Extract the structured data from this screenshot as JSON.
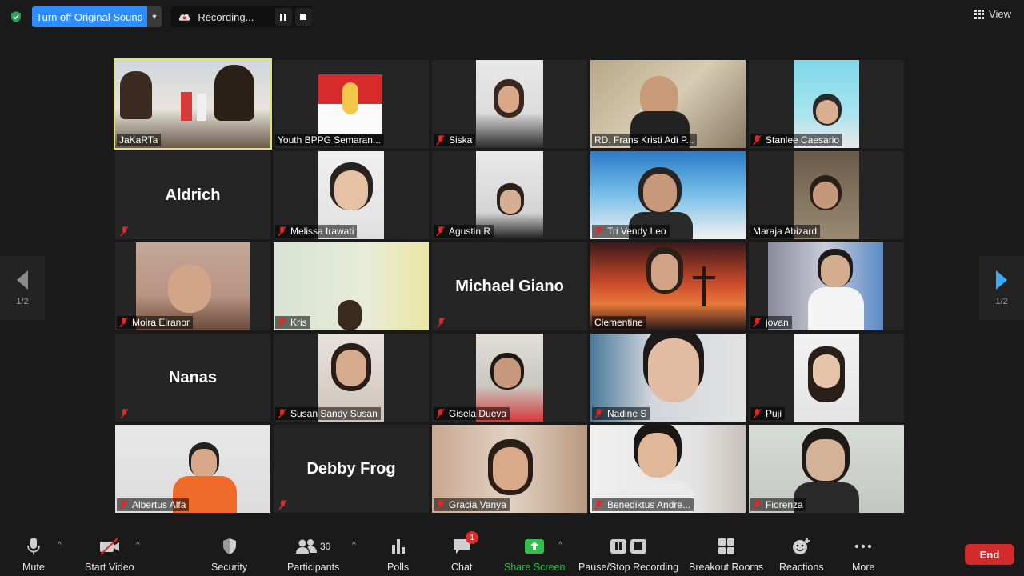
{
  "top": {
    "original_sound_label": "Turn off Original Sound",
    "recording_label": "Recording...",
    "view_label": "View"
  },
  "nav": {
    "page_left": "1/2",
    "page_right": "1/2"
  },
  "tiles": [
    {
      "name": "JaKaRTa"
    },
    {
      "name": "Youth BPPG Semaran..."
    },
    {
      "name": "Siska"
    },
    {
      "name": "RD. Frans Kristi Adi P..."
    },
    {
      "name": "Stanlee Caesario"
    },
    {
      "name": "Aldrich"
    },
    {
      "name": "Melissa Irawati"
    },
    {
      "name": "Agustin R"
    },
    {
      "name": "Tri Vendy Leo"
    },
    {
      "name": "Maraja Abizard"
    },
    {
      "name": "Moira Elranor"
    },
    {
      "name": "Kris"
    },
    {
      "name": "Michael Giano"
    },
    {
      "name": "Clementine"
    },
    {
      "name": "jovan"
    },
    {
      "name": "Nanas"
    },
    {
      "name": "Susan Sandy Susan"
    },
    {
      "name": "Gisela Dueva"
    },
    {
      "name": "Nadine S"
    },
    {
      "name": "Puji"
    },
    {
      "name": "Albertus Alfa"
    },
    {
      "name": "Debby Frog"
    },
    {
      "name": "Gracia Vanya"
    },
    {
      "name": "Benediktus Andre..."
    },
    {
      "name": "Fiorenza"
    }
  ],
  "toolbar": {
    "mute": "Mute",
    "start_video": "Start Video",
    "security": "Security",
    "participants": "Participants",
    "participants_count": "30",
    "polls": "Polls",
    "chat": "Chat",
    "chat_badge": "1",
    "share_screen": "Share Screen",
    "pause_stop_recording": "Pause/Stop Recording",
    "breakout_rooms": "Breakout Rooms",
    "reactions": "Reactions",
    "more": "More",
    "end": "End"
  },
  "colors": {
    "accent_blue": "#2d8cff",
    "share_green": "#2fbf4a",
    "end_red": "#d12b2b",
    "active_speaker": "#e2e36b",
    "muted_red": "#e02828"
  }
}
